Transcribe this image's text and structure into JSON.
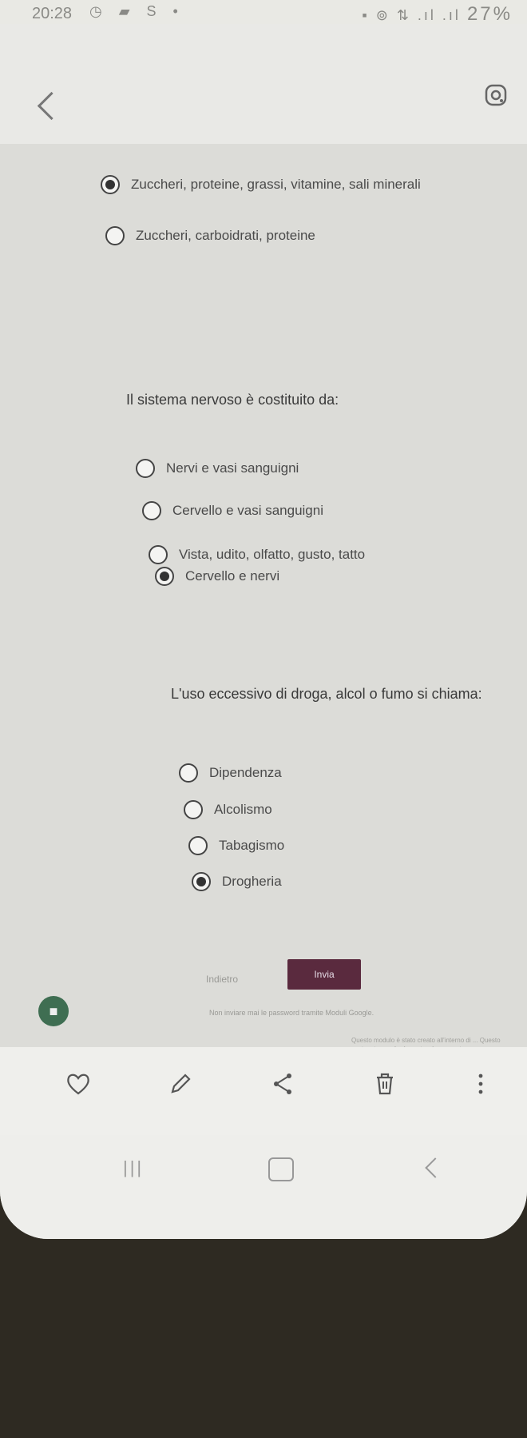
{
  "status_bar": {
    "time": "20:28",
    "left_icons": "◷ ▰ S •",
    "right_icons": "▪ ⊚ ⇅ .ıl .ıl",
    "battery": "27%"
  },
  "questions": [
    {
      "text": "",
      "options": [
        {
          "label": "Zuccheri, proteine, grassi, vitamine, sali minerali",
          "selected": true
        },
        {
          "label": "Zuccheri, carboidrati, proteine",
          "selected": false
        }
      ]
    },
    {
      "text": "Il sistema nervoso è costituito da:",
      "options": [
        {
          "label": "Nervi e vasi sanguigni",
          "selected": false
        },
        {
          "label": "Cervello e vasi sanguigni",
          "selected": false
        },
        {
          "label": "Vista, udito, olfatto, gusto, tatto",
          "selected": false
        },
        {
          "label": "Cervello e nervi",
          "selected": true
        }
      ]
    },
    {
      "text": "L'uso eccessivo di droga, alcol o fumo si chiama:",
      "options": [
        {
          "label": "Dipendenza",
          "selected": false
        },
        {
          "label": "Alcolismo",
          "selected": false
        },
        {
          "label": "Tabagismo",
          "selected": false
        },
        {
          "label": "Drogheria",
          "selected": true
        }
      ]
    }
  ],
  "buttons": {
    "back": "Indietro",
    "submit": "Invia"
  },
  "footer": {
    "note": "Non inviare mai le password tramite Moduli Google.",
    "note2": "Questo modulo è stato creato all'interno di ... Questo contenuto non è né creato né approvato"
  },
  "icons": {
    "back": "chevron-left-icon",
    "lens": "google-lens-icon",
    "heart": "heart-icon",
    "edit": "pencil-icon",
    "share": "share-icon",
    "delete": "trash-icon",
    "more": "more-vertical-icon"
  }
}
